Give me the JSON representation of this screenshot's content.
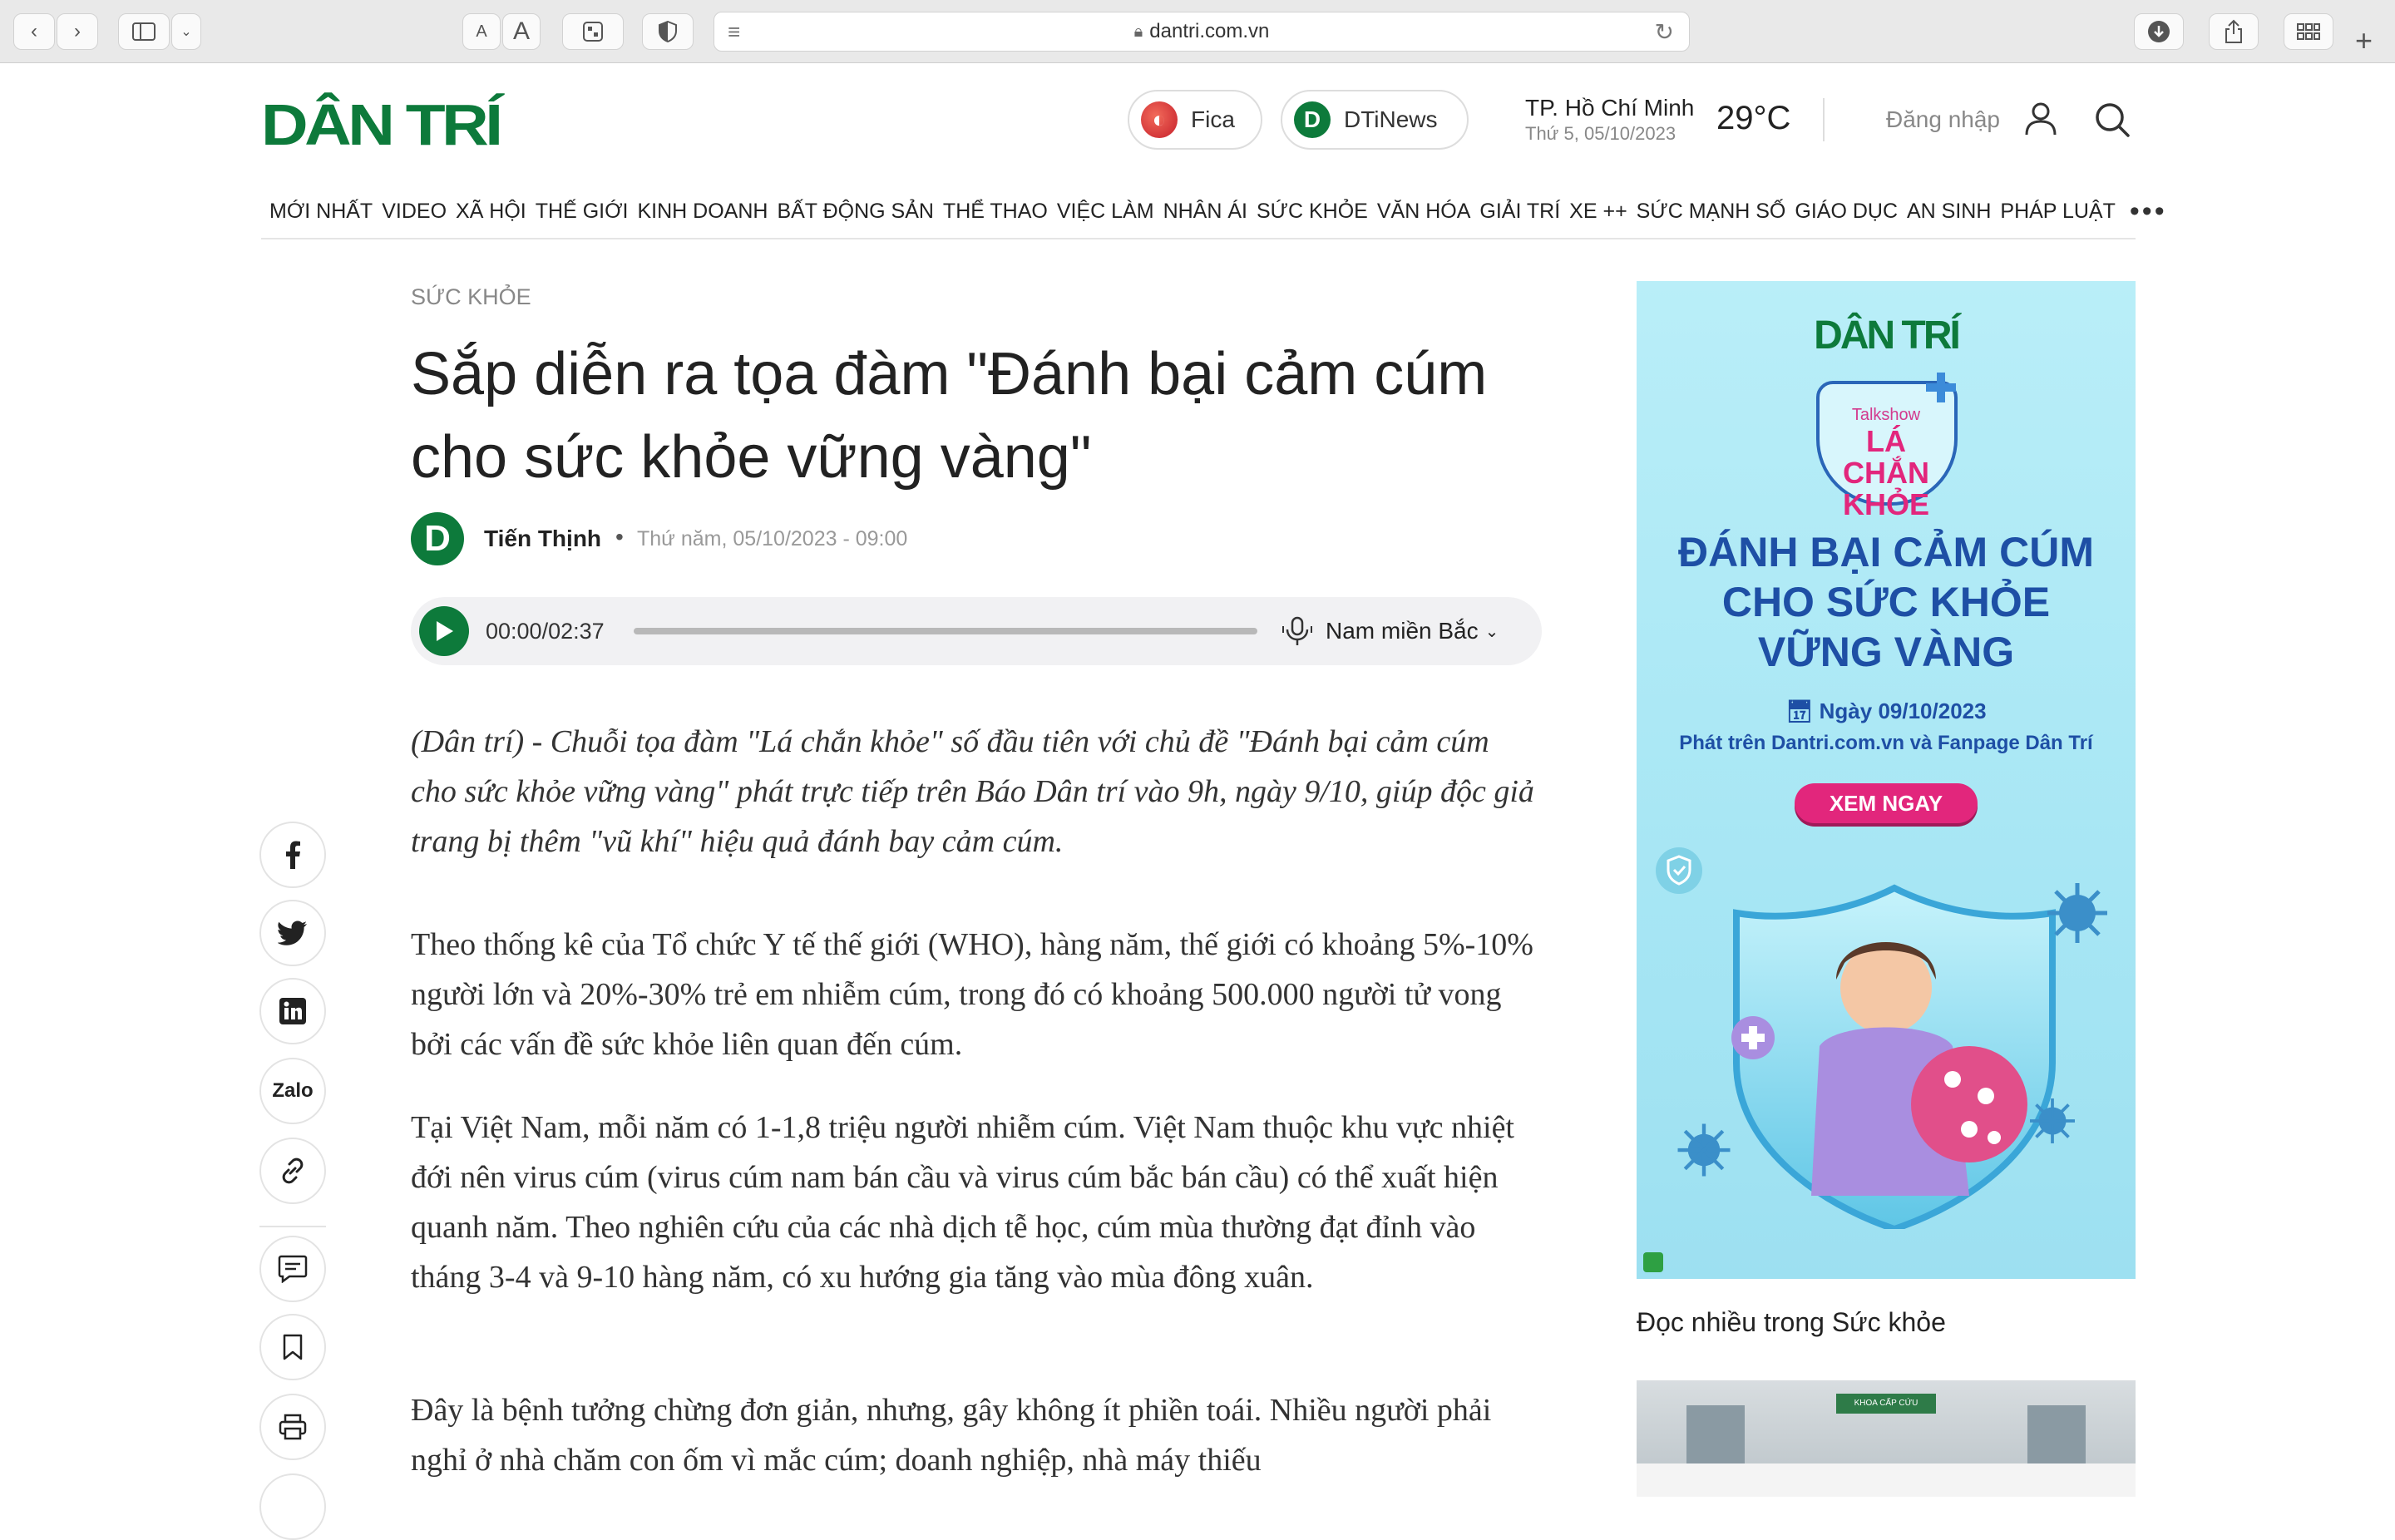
{
  "browser": {
    "url": "dantri.com.vn",
    "text_small_label": "A",
    "text_large_label": "A"
  },
  "header": {
    "logo": "DÂN TRÍ",
    "fica": "Fica",
    "dtinews": "DTiNews",
    "dtinews_icon_letter": "D",
    "weather_city": "TP. Hồ Chí Minh",
    "weather_date": "Thứ 5, 05/10/2023",
    "weather_temp": "29°C",
    "login": "Đăng nhập"
  },
  "nav": {
    "items": [
      "MỚI NHẤT",
      "VIDEO",
      "XÃ HỘI",
      "THẾ GIỚI",
      "KINH DOANH",
      "BẤT ĐỘNG SẢN",
      "THỂ THAO",
      "VIỆC LÀM",
      "NHÂN ÁI",
      "SỨC KHỎE",
      "VĂN HÓA",
      "GIẢI TRÍ",
      "XE ++",
      "SỨC MẠNH SỐ",
      "GIÁO DỤC",
      "AN SINH",
      "PHÁP LUẬT"
    ],
    "more": "•••"
  },
  "article": {
    "category": "SỨC KHỎE",
    "title": "Sắp diễn ra tọa đàm \"Đánh bại cảm cúm cho sức khỏe vững vàng\"",
    "author_icon_letter": "D",
    "author": "Tiến Thịnh",
    "separator": "•",
    "date": "Thứ năm, 05/10/2023 - 09:00",
    "audio": {
      "time": "00:00/02:37",
      "voice": "Nam miền Bắc",
      "progress": 0
    },
    "sapo": "(Dân trí) - Chuỗi tọa đàm \"Lá chắn khỏe\" số đầu tiên với chủ đề \"Đánh bại cảm cúm cho sức khỏe vững vàng\" phát trực tiếp trên Báo Dân trí vào 9h, ngày 9/10, giúp độc giả trang bị thêm \"vũ khí\" hiệu quả đánh bay cảm cúm.",
    "paragraphs": [
      "Theo thống kê của Tổ chức Y tế thế giới (WHO), hàng năm, thế giới có khoảng 5%-10% người lớn và 20%-30% trẻ em nhiễm cúm, trong đó có khoảng 500.000 người tử vong bởi các vấn đề sức khỏe liên quan đến cúm.",
      "Tại Việt Nam, mỗi năm có 1-1,8 triệu người nhiễm cúm. Việt Nam thuộc khu vực nhiệt đới nên virus cúm (virus cúm nam bán cầu và virus cúm bắc bán cầu) có thể xuất hiện quanh năm. Theo nghiên cứu của các nhà dịch tễ học, cúm mùa thường đạt đỉnh vào tháng 3-4 và 9-10 hàng năm, có xu hướng gia tăng vào mùa đông xuân.",
      "Đây là bệnh tưởng chừng đơn giản, nhưng, gây không ít phiền toái. Nhiều người phải nghỉ ở nhà chăm con ốm vì mắc cúm; doanh nghiệp, nhà máy thiếu"
    ]
  },
  "social": {
    "zalo": "Zalo"
  },
  "ad": {
    "logo": "DÂN TRÍ",
    "talkshow": "Talkshow",
    "talkshow_name": "LÁ CHẮN KHỎE",
    "headline": "ĐÁNH BẠI CẢM CÚM CHO SỨC KHỎE VỮNG VÀNG",
    "date": "Ngày 09/10/2023",
    "sub": "Phát trên Dantri.com.vn và Fanpage Dân Trí",
    "cta": "XEM NGAY"
  },
  "sidebar": {
    "popular_title": "Đọc nhiều trong Sức khỏe",
    "thumb_sign": "KHOA CẤP CỨU"
  },
  "colors": {
    "brand_green": "#0d7a3b",
    "ad_blue": "#1e4fa5",
    "ad_pink": "#e2267c"
  }
}
